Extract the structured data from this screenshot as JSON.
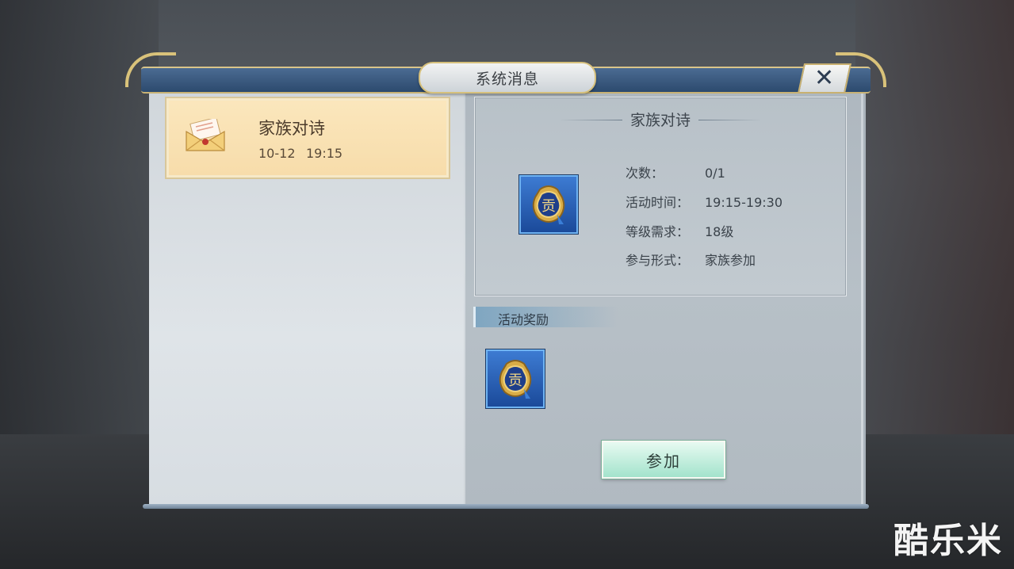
{
  "dialog": {
    "title": "系统消息",
    "close_symbol": "✕"
  },
  "mail_list": {
    "items": [
      {
        "title": "家族对诗",
        "date": "10-12",
        "time": "19:15",
        "icon": "envelope-icon"
      }
    ]
  },
  "detail": {
    "title": "家族对诗",
    "item_icon": "contribution-token-icon",
    "rows": [
      {
        "label": "次数：",
        "value": "0/1"
      },
      {
        "label": "活动时间：",
        "value": "19:15-19:30"
      },
      {
        "label": "等级需求：",
        "value": "18级"
      },
      {
        "label": "参与形式：",
        "value": "家族参加"
      }
    ],
    "reward_header": "活动奖励",
    "reward_icon": "contribution-token-icon",
    "join_button": "参加"
  },
  "watermark": "酷乐米",
  "colors": {
    "title_bar": "#2c4a6e",
    "gold_trim": "#d9c27a",
    "mail_item_bg": "#f7dcaa",
    "join_button": "#a3e3cc",
    "icon_frame": "#1b4a9a"
  }
}
